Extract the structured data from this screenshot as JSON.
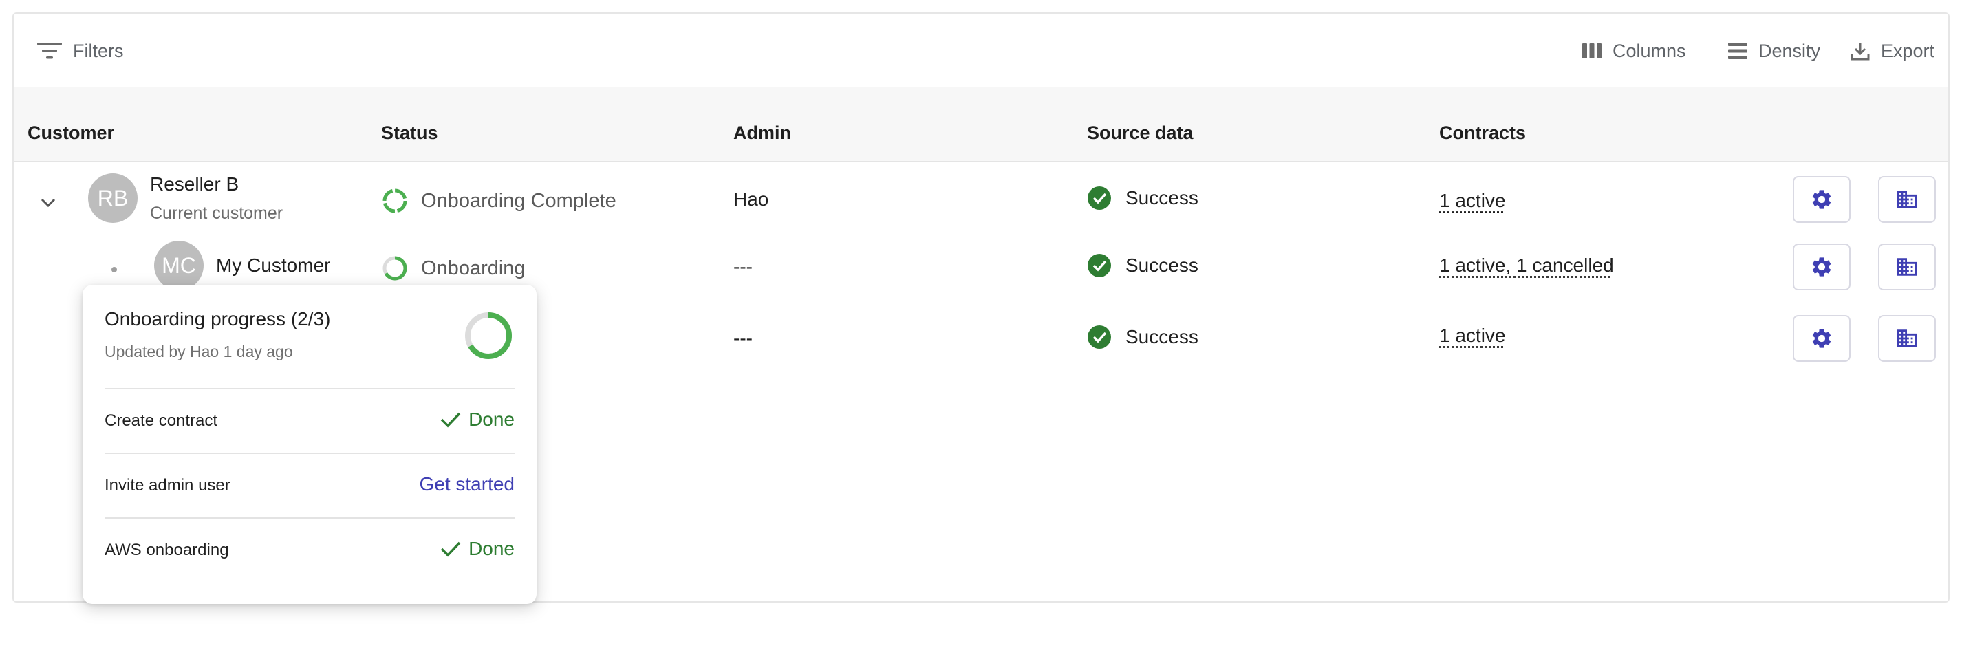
{
  "toolbar": {
    "filters_label": "Filters",
    "columns_label": "Columns",
    "density_label": "Density",
    "export_label": "Export"
  },
  "columns": [
    "Customer",
    "Status",
    "Admin",
    "Source data",
    "Contracts"
  ],
  "rows": [
    {
      "avatar_initials": "RB",
      "customer_name": "Reseller B",
      "customer_sub": "Current customer",
      "status": "Onboarding Complete",
      "admin": "Hao",
      "source": "Success",
      "contracts": "1 active"
    },
    {
      "avatar_initials": "MC",
      "customer_name": "My Customer",
      "status": "Onboarding",
      "admin": "---",
      "source": "Success",
      "contracts": "1 active, 1 cancelled"
    },
    {
      "admin": "---",
      "source": "Success",
      "contracts": "1 active"
    }
  ],
  "popover": {
    "title": "Onboarding progress (2/3)",
    "subtitle": "Updated by Hao 1 day ago",
    "progress_fraction": 0.667,
    "steps": [
      {
        "label": "Create contract",
        "action": "Done"
      },
      {
        "label": "Invite admin user",
        "action": "Get started"
      },
      {
        "label": "AWS onboarding",
        "action": "Done"
      }
    ]
  },
  "colors": {
    "success_green": "#2e7d32",
    "ring_green": "#4caf50",
    "accent_indigo": "#3f3fb3"
  },
  "icons": {
    "filters": "filter-icon",
    "columns": "columns-icon",
    "density": "density-icon",
    "export": "export-icon",
    "expand": "chevron-down-icon",
    "success": "check-circle-icon",
    "settings": "gear-icon",
    "organization": "building-icon"
  }
}
